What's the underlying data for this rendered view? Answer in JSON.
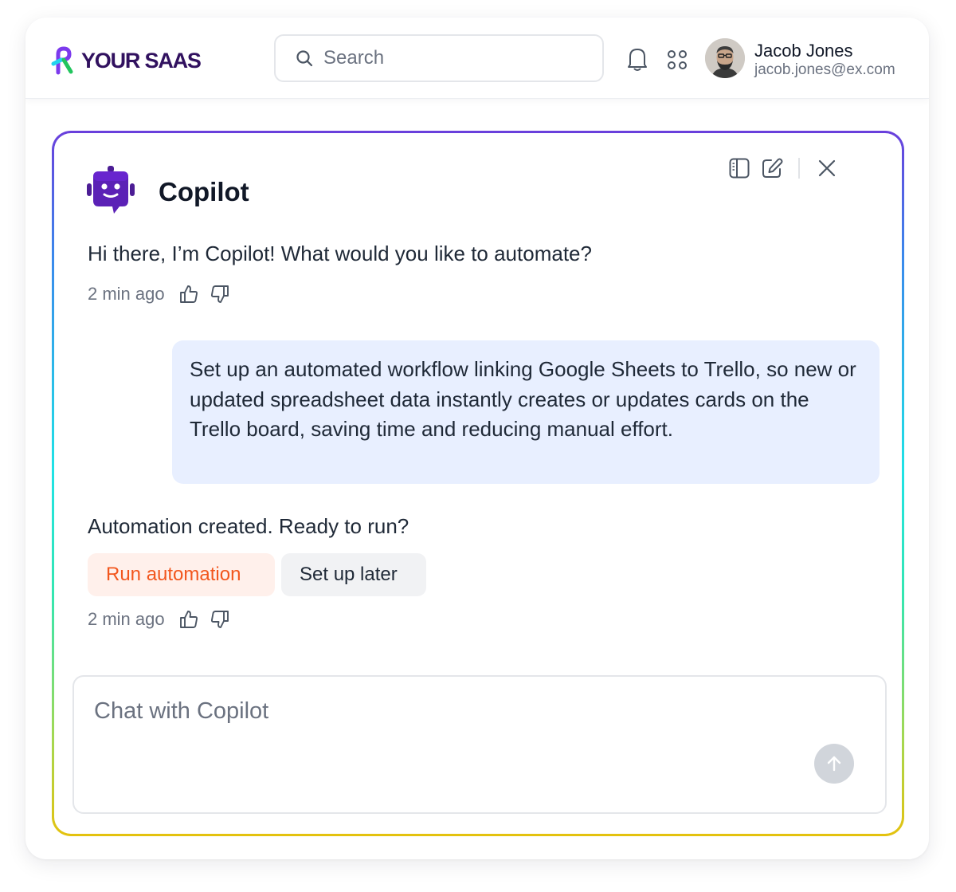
{
  "header": {
    "brand": "YOUR SAAS",
    "search_placeholder": "Search",
    "user": {
      "name": "Jacob Jones",
      "email": "jacob.jones@ex.com"
    }
  },
  "panel": {
    "title": "Copilot",
    "toolbar": {
      "icons": [
        "sidebar-toggle-icon",
        "edit-icon",
        "close-icon"
      ]
    },
    "messages": [
      {
        "role": "assistant",
        "text": "Hi there, I’m Copilot! What would you like to automate?",
        "time": "2 min ago"
      },
      {
        "role": "user",
        "text": "Set up an automated workflow linking Google Sheets to Trello, so new or updated spreadsheet data instantly creates or updates cards on the Trello board, saving time and reducing manual effort."
      },
      {
        "role": "assistant",
        "text": "Automation created. Ready to run?",
        "time": "2 min ago",
        "actions": [
          "Run automation",
          "Set up later"
        ]
      }
    ],
    "composer": {
      "placeholder": "Chat with Copilot",
      "value": ""
    }
  },
  "colors": {
    "brand": "#31115f",
    "bot": "#5b21b6",
    "run_accent": "#f2561d",
    "user_bubble": "#e8efff",
    "gradient": [
      "#6a3fdc",
      "#3a89ec",
      "#1fe2e6",
      "#35e6b0",
      "#a3d852",
      "#e4c20e"
    ]
  }
}
